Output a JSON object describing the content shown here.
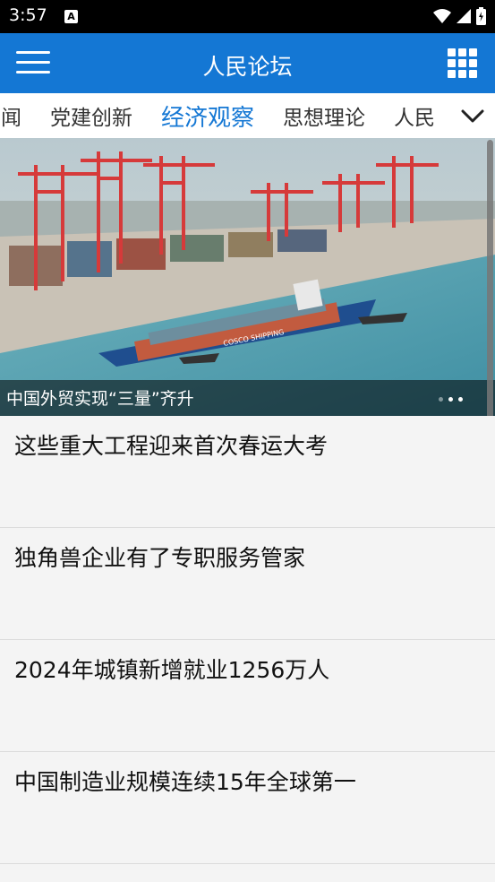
{
  "status_bar": {
    "time": "3:57",
    "notif_glyph": "A"
  },
  "app_bar": {
    "title": "人民论坛",
    "menu_icon": "hamburger-menu-icon",
    "grid_icon": "grid-apps-icon"
  },
  "tabs": [
    {
      "label": "要闻",
      "active": false
    },
    {
      "label": "党建创新",
      "active": false
    },
    {
      "label": "经济观察",
      "active": true
    },
    {
      "label": "思想理论",
      "active": false
    },
    {
      "label": "人民",
      "active": false
    }
  ],
  "banner": {
    "caption": "中国外贸实现“三量”齐升",
    "ship_text": "COSCO SHIPPING"
  },
  "news": [
    {
      "title": "这些重大工程迎来首次春运大考"
    },
    {
      "title": "独角兽企业有了专职服务管家"
    },
    {
      "title": "2024年城镇新增就业1256万人"
    },
    {
      "title": "中国制造业规模连续15年全球第一"
    }
  ],
  "colors": {
    "primary": "#1477d4",
    "active_tab": "#1477d4",
    "background": "#f4f4f4"
  }
}
